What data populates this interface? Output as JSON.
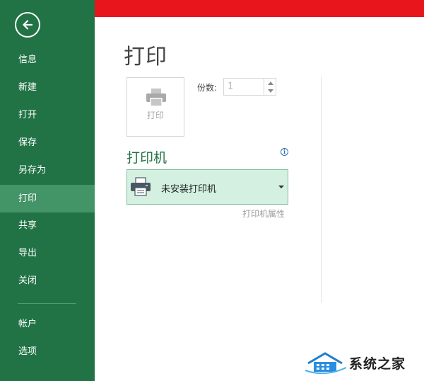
{
  "sidebar": {
    "back_icon": "back-arrow-icon",
    "items": [
      {
        "label": "信息"
      },
      {
        "label": "新建"
      },
      {
        "label": "打开"
      },
      {
        "label": "保存"
      },
      {
        "label": "另存为"
      },
      {
        "label": "打印",
        "active": true
      },
      {
        "label": "共享"
      },
      {
        "label": "导出"
      },
      {
        "label": "关闭"
      },
      {
        "label": "帐户"
      },
      {
        "label": "选项"
      }
    ],
    "colors": {
      "background": "#217346",
      "active": "#439467"
    }
  },
  "top_bar": {
    "color": "#e8151c"
  },
  "main": {
    "title": "打印",
    "print_button": {
      "label": "打印",
      "icon": "printer-icon"
    },
    "copies": {
      "label": "份数:",
      "value": "1"
    },
    "printer": {
      "heading": "打印机",
      "info_icon": "info-icon",
      "selected": "未安装打印机",
      "icon": "printer-icon",
      "properties_link": "打印机属性"
    }
  },
  "watermark": {
    "text": "系统之家"
  }
}
